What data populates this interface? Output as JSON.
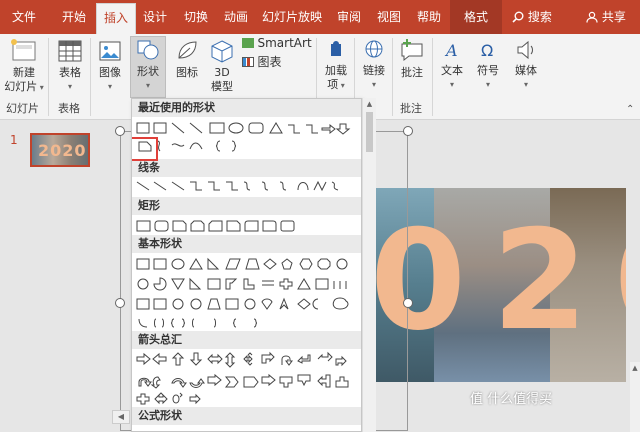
{
  "tabs": [
    "文件",
    "开始",
    "插入",
    "设计",
    "切换",
    "动画",
    "幻灯片放映",
    "审阅",
    "视图",
    "帮助",
    "格式"
  ],
  "active_tab": "插入",
  "search_label": "搜索",
  "share_label": "共享",
  "ribbon": {
    "new_slide": {
      "line1": "新建",
      "line2": "幻灯片"
    },
    "table": "表格",
    "image": "图像",
    "shapes": "形状",
    "icons": "图标",
    "model3d": {
      "line1": "3D",
      "line2": "模型"
    },
    "smartart": "SmartArt",
    "chart": "图表",
    "addin": {
      "line1": "加载",
      "line2": "项"
    },
    "link": "链接",
    "comment": "批注",
    "text": "文本",
    "symbol": "符号",
    "media": "媒体"
  },
  "groups": {
    "slides": "幻灯片",
    "tables": "表格",
    "comments": "批注"
  },
  "slide_number": "1",
  "thumbnail_text": "2020",
  "slide_text": "020",
  "shapes_menu": {
    "recent": "最近使用的形状",
    "lines": "线条",
    "rect": "矩形",
    "basic": "基本形状",
    "arrows": "箭头总汇",
    "equation": "公式形状"
  },
  "watermark": "值 什么值得买",
  "colors": {
    "accent": "#c0432b",
    "digits": "#f2b88f"
  }
}
